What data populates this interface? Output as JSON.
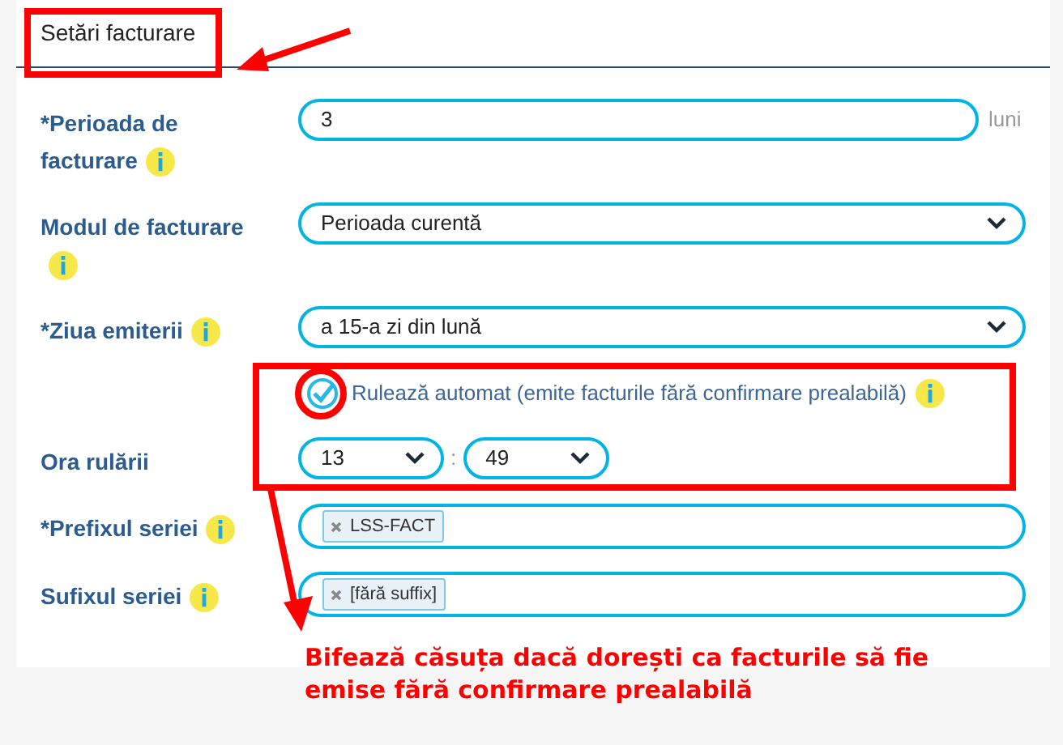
{
  "section_title": "Setări facturare",
  "required_mark": "*",
  "fields": [
    {
      "kind": "number",
      "label": "Perioada de facturare",
      "required": true,
      "info": true,
      "value": "3",
      "suffix": "luni"
    },
    {
      "kind": "select",
      "label": "Modul de facturare",
      "required": false,
      "info": true,
      "value": "Perioada curentă"
    },
    {
      "kind": "select",
      "label": "Ziua emiterii",
      "required": true,
      "info": true,
      "value": "a 15-a zi din lună"
    },
    {
      "kind": "checkbox",
      "label": "Rulează automat (emite facturile fără confirmare prealabilă)",
      "checked": true,
      "info": true
    },
    {
      "kind": "time",
      "label": "Ora rulării",
      "required": false,
      "info": false,
      "hour": "13",
      "minute": "49",
      "separator": ":"
    },
    {
      "kind": "tags",
      "label": "Prefixul seriei",
      "required": true,
      "info": true,
      "tags": [
        "LSS-FACT"
      ]
    },
    {
      "kind": "tags",
      "label": "Sufixul seriei",
      "required": false,
      "info": true,
      "tags": [
        "[fără suffix]"
      ]
    }
  ],
  "annotation": {
    "text": "Bifează căsuța dacă dorești ca facturile să fie emise fără confirmare prealabilă"
  }
}
